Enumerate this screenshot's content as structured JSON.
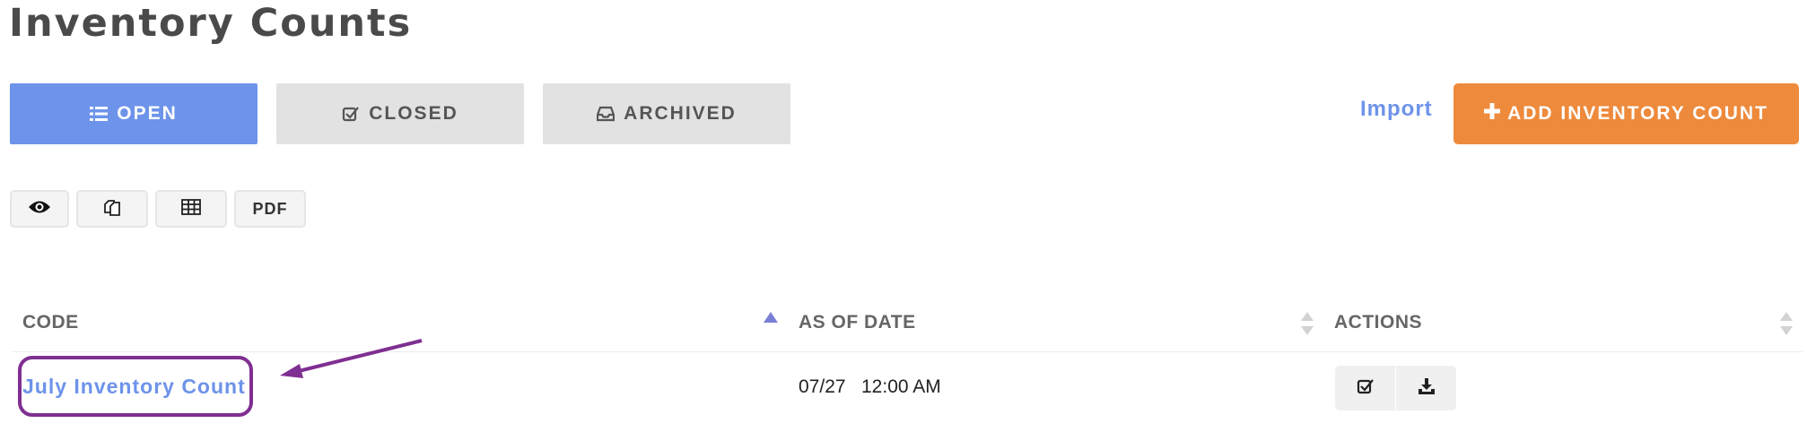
{
  "page": {
    "title": "Inventory Counts"
  },
  "tabs": [
    {
      "label": "OPEN",
      "icon": "list-icon",
      "active": true
    },
    {
      "label": "CLOSED",
      "icon": "checkbox-icon",
      "active": false
    },
    {
      "label": "ARCHIVED",
      "icon": "inbox-icon",
      "active": false
    }
  ],
  "toolbar": {
    "import_label": "Import",
    "add_label": "ADD INVENTORY COUNT",
    "add_icon": "plus-icon",
    "tools": [
      {
        "icon": "eye-icon"
      },
      {
        "icon": "copy-icon"
      },
      {
        "icon": "table-icon"
      },
      {
        "label": "PDF"
      }
    ]
  },
  "table": {
    "headers": [
      "CODE",
      "AS OF DATE",
      "ACTIONS"
    ],
    "rows": [
      {
        "code": "July Inventory Count",
        "date": "07/27",
        "time": "12:00 AM",
        "actions": [
          "check-icon",
          "download-icon"
        ]
      }
    ]
  },
  "colors": {
    "accent_blue": "#6d93ea",
    "accent_orange": "#ee8a3c",
    "annotation_purple": "#7f2f91"
  }
}
